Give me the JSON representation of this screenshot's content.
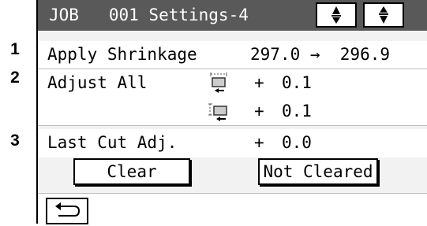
{
  "callouts": [
    "1",
    "2",
    "3"
  ],
  "title": "JOB   001 Settings-4",
  "rows": {
    "apply_shrinkage": {
      "label": "Apply Shrinkage",
      "value": "297.0 →  296.9"
    },
    "adjust_all": {
      "label": "Adjust All",
      "sign1": "+",
      "value1": "0.1",
      "sign2": "+",
      "value2": "0.1"
    },
    "last_cut": {
      "label": "Last Cut Adj.",
      "sign": "+",
      "value": "0.0"
    }
  },
  "buttons": {
    "clear": "Clear",
    "not_cleared": "Not Cleared"
  },
  "icons": {
    "scroll_up": "scroll-up-icon",
    "scroll_down": "scroll-down-icon",
    "feed_horizontal": "horizontal-feed-adjust-icon",
    "feed_vertical": "vertical-feed-adjust-icon",
    "back": "return-icon"
  },
  "colors": {
    "titlebar": "#595959",
    "panel": "#f2f2f2",
    "text": "#000000"
  }
}
